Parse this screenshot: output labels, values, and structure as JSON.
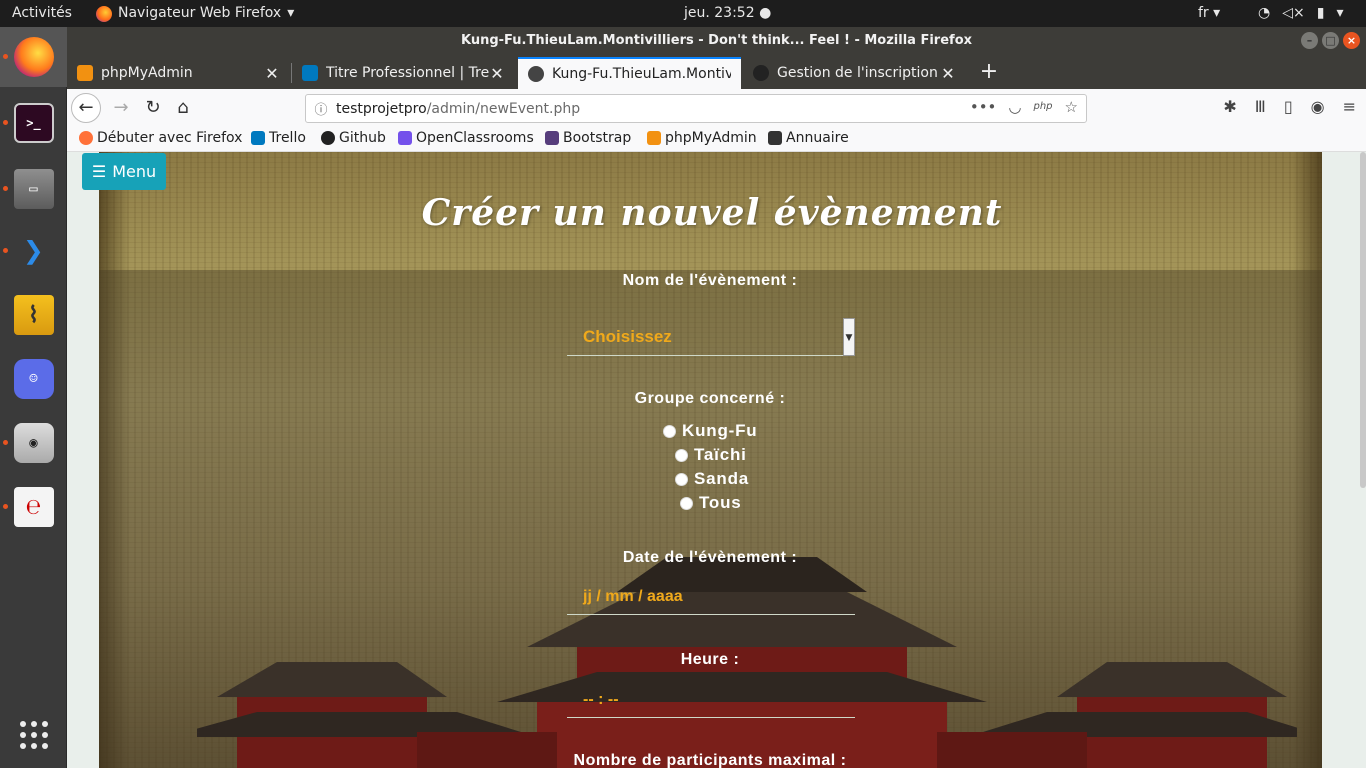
{
  "topbar": {
    "activities": "Activités",
    "app_name": "Navigateur Web Firefox",
    "clock": "jeu. 23:52",
    "lang": "fr"
  },
  "window": {
    "title": "Kung-Fu.ThieuLam.Montivilliers - Don't think... Feel ! - Mozilla Firefox"
  },
  "tabs": [
    {
      "label": "phpMyAdmin",
      "favicon_color": "#f29111"
    },
    {
      "label": "Titre Professionnel | Trello",
      "favicon_color": "#0079bf"
    },
    {
      "label": "Kung-Fu.ThieuLam.Montivilliers",
      "favicon_color": "#444444"
    },
    {
      "label": "Gestion de l'inscription e",
      "favicon_color": "#222222"
    }
  ],
  "url": {
    "host": "testprojetpro",
    "path": "/admin/newEvent.php",
    "info_icon": "ⓘ"
  },
  "bookmarks": [
    {
      "label": "Débuter avec Firefox",
      "icon": "firefox-icon",
      "color": "#ff7139"
    },
    {
      "label": "Trello",
      "icon": "trello-icon",
      "color": "#0079bf"
    },
    {
      "label": "Github",
      "icon": "github-icon",
      "color": "#222222"
    },
    {
      "label": "OpenClassrooms",
      "icon": "openclassrooms-icon",
      "color": "#7451eb"
    },
    {
      "label": "Bootstrap",
      "icon": "bootstrap-icon",
      "color": "#563d7c"
    },
    {
      "label": "phpMyAdmin",
      "icon": "phpmyadmin-icon",
      "color": "#f29111"
    },
    {
      "label": "Annuaire",
      "icon": "annuaire-icon",
      "color": "#333333"
    }
  ],
  "page": {
    "menu_label": "Menu",
    "title": "Créer un nouvel évènement",
    "event_name_label": "Nom de l'évènement :",
    "event_select_value": "Choisissez",
    "group_label": "Groupe concerné :",
    "groups": [
      "Kung-Fu",
      "Taïchi",
      "Sanda",
      "Tous"
    ],
    "date_label": "Date de l'évènement :",
    "date_placeholder": "jj / mm / aaaa",
    "time_label": "Heure :",
    "time_placeholder": "-- : --",
    "max_participants_label": "Nombre de participants maximal :"
  },
  "colors": {
    "accent_input_text": "#f0a91b",
    "menu_button": "#17a2b8",
    "dock_running": "#e95420"
  }
}
